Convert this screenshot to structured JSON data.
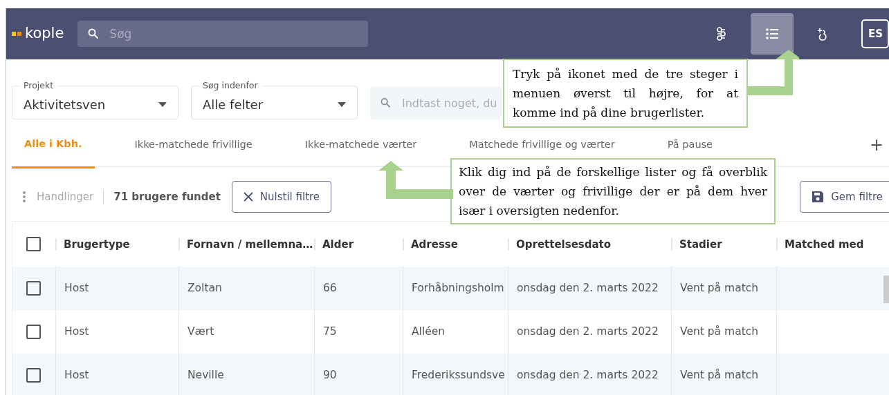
{
  "navbar": {
    "logo": "kople",
    "search_placeholder": "Søg",
    "buttons": [
      {
        "kind": "links",
        "selected": false
      },
      {
        "kind": "list",
        "selected": true
      },
      {
        "kind": "add-user",
        "selected": false
      }
    ],
    "avatar": "ES"
  },
  "filters": [
    {
      "label": "Projekt",
      "value": "Aktivitetsven"
    },
    {
      "label": "Søg indenfor",
      "value": "Alle felter"
    }
  ],
  "search": {
    "placeholder": "Indtast noget, du"
  },
  "tabs": [
    {
      "label": "Alle i Kbh.",
      "selected": true
    },
    {
      "label": "Ikke-matchede frivillige",
      "selected": false
    },
    {
      "label": "Ikke-matchede værter",
      "selected": false
    },
    {
      "label": "Matchede frivillige og værter",
      "selected": false
    },
    {
      "label": "På pause",
      "selected": false
    }
  ],
  "add_tab": "+",
  "toolbar": {
    "actions": {
      "label": "Handlinger",
      "disabled": true
    },
    "count": "71 brugere fundet",
    "reset": "Nulstil filtre",
    "save": "Gem filtre"
  },
  "table": {
    "select_all_checked": false,
    "columns": [
      "Brugertype",
      "Fornavn / mellemna…",
      "Alder",
      "Adresse",
      "Oprettelsesdato",
      "Stadier",
      "Matched med"
    ],
    "rows": [
      {
        "checked": false,
        "cells": [
          "Host",
          "Zoltan",
          "66",
          "Forhåbningsholm",
          "onsdag den 2. marts 2022",
          "Vent på match",
          ""
        ]
      },
      {
        "checked": false,
        "cells": [
          "Host",
          "Vært",
          "75",
          "Alléen",
          "onsdag den 2. marts 2022",
          "Vent på match",
          ""
        ]
      },
      {
        "checked": false,
        "cells": [
          "Host",
          "Neville",
          "90",
          "Frederikssundsve",
          "onsdag den 2. marts 2022",
          "Vent på match",
          ""
        ]
      }
    ]
  },
  "callouts": [
    "Tryk på ikonet med de tre steger i menuen øverst til højre, for at komme ind på dine brugerlister.",
    "Klik dig ind på de forskellige lister og få overblik over de værter og frivillige der er på dem hver især i oversigten nedenfor."
  ]
}
